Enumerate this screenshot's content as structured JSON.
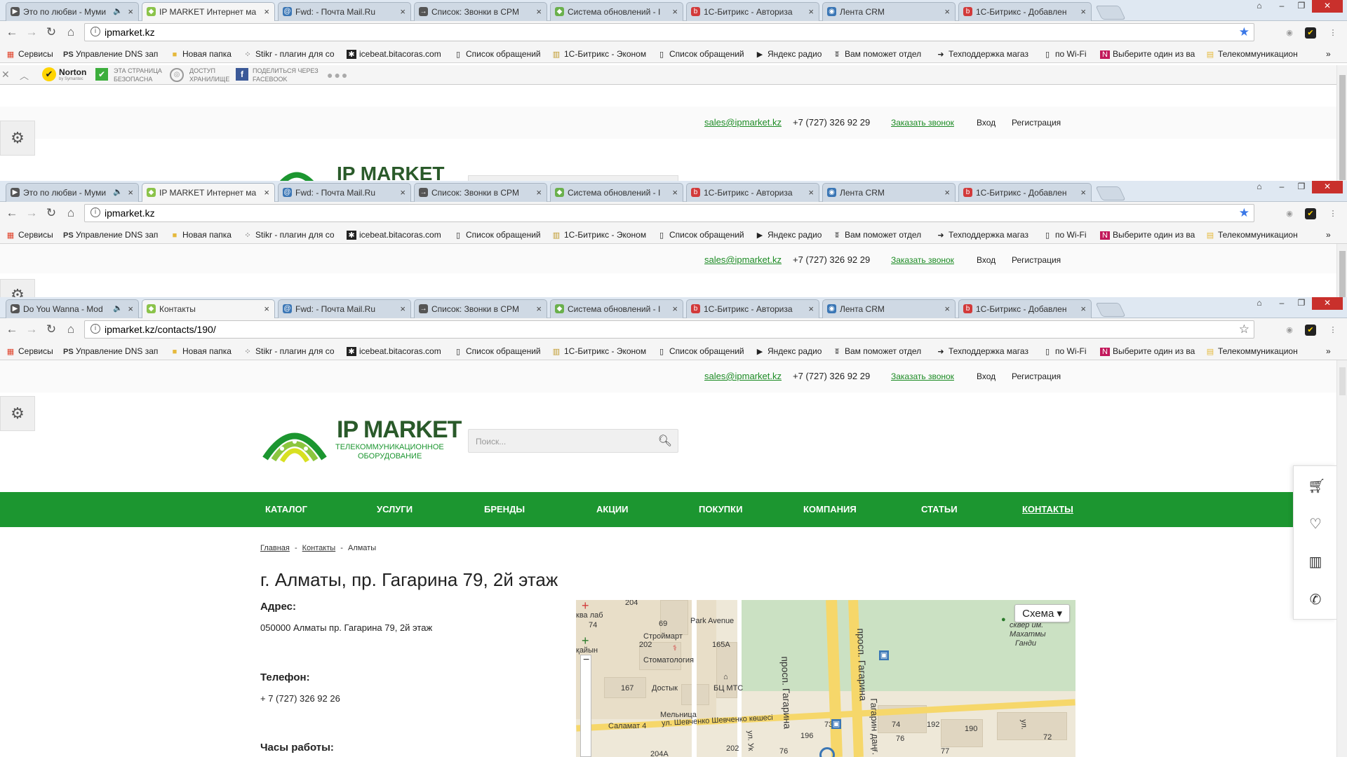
{
  "window1": {
    "tabs": [
      {
        "title": "Это по любви - Муми"
      },
      {
        "title": "IP MARKET Интернет ма"
      },
      {
        "title": "Fwd: - Почта Mail.Ru"
      },
      {
        "title": "Список: Звонки в CPM"
      },
      {
        "title": "Система обновлений - I"
      },
      {
        "title": "1С-Битрикс - Авториза"
      },
      {
        "title": "Лента CRM"
      },
      {
        "title": "1С-Битрикс - Добавлен"
      }
    ],
    "url": "ipmarket.kz"
  },
  "window2": {
    "tabs": [
      {
        "title": "Это по любви - Муми"
      },
      {
        "title": "IP MARKET Интернет ма"
      },
      {
        "title": "Fwd: - Почта Mail.Ru"
      },
      {
        "title": "Список: Звонки в CPM"
      },
      {
        "title": "Система обновлений - I"
      },
      {
        "title": "1С-Битрикс - Авториза"
      },
      {
        "title": "Лента CRM"
      },
      {
        "title": "1С-Битрикс - Добавлен"
      }
    ],
    "url": "ipmarket.kz"
  },
  "window3": {
    "tabs": [
      {
        "title": "Do You Wanna - Mod"
      },
      {
        "title": "Контакты"
      },
      {
        "title": "Fwd: - Почта Mail.Ru"
      },
      {
        "title": "Список: Звонки в CPM"
      },
      {
        "title": "Система обновлений - I"
      },
      {
        "title": "1С-Битрикс - Авториза"
      },
      {
        "title": "Лента CRM"
      },
      {
        "title": "1С-Битрикс - Добавлен"
      }
    ],
    "url": "ipmarket.kz/contacts/190/"
  },
  "bookmarks": [
    "Сервисы",
    "Управление DNS зап",
    "Новая папка",
    "Stikr - плагин для со",
    "icebeat.bitacoras.com",
    "Список обращений",
    "1С-Битрикс - Эконом",
    "Список обращений",
    "Яндекс радио",
    "Вам поможет отдел",
    "Техподдержка магаз",
    "по Wi-Fi",
    "Выберите один из ва",
    "Телекоммуникацион"
  ],
  "norton": {
    "brand": "Norton",
    "brand_sub": "by Symantec",
    "safe_1": "ЭТА СТРАНИЦА",
    "safe_2": "БЕЗОПАСНА",
    "vault_1": "ДОСТУП",
    "vault_2": "ХРАНИЛИЩЕ",
    "fb_1": "ПОДЕЛИТЬСЯ ЧЕРЕЗ",
    "fb_2": "FACEBOOK"
  },
  "site": {
    "email": "sales@ipmarket.kz",
    "phone": "+7 (727) 326 92 29",
    "callback": "Заказать звонок",
    "login": "Вход",
    "register": "Регистрация",
    "logo_title": "IP MARKET",
    "logo_sub1": "ТЕЛЕКОММУНИКАЦИОННОЕ",
    "logo_sub2": "ОБОРУДОВАНИЕ",
    "search_placeholder": "Поиск...",
    "menu": [
      "КАТАЛОГ",
      "УСЛУГИ",
      "БРЕНДЫ",
      "АКЦИИ",
      "ПОКУПКИ",
      "КОМПАНИЯ",
      "СТАТЬИ",
      "КОНТАКТЫ"
    ],
    "breadcrumbs": [
      "Главная",
      "Контакты",
      "Алматы"
    ],
    "page_title": "г. Алматы, пр. Гагарина 79, 2й этаж",
    "address_label": "Адрес:",
    "address_value": "050000 Алматы пр. Гагарина 79, 2й этаж",
    "phone_label": "Телефон:",
    "phone_value": "+ 7 (727) 326 92 26",
    "hours_label": "Часы работы:"
  },
  "map": {
    "type_button": "Схема ▾",
    "labels": {
      "park_avenue": "Park Avenue",
      "stroymart": "Строймарт",
      "stomatology": "Стоматология",
      "bc_mts": "БЦ МТС",
      "dostyk": "Достык",
      "melnitsa": "Мельница",
      "salamat": "Саламат 4",
      "shevchenko": "ул. Шевченко Шевченко көшесі",
      "gagarin": "просп. Гагарина",
      "gagarin2": "Гагарин даңғ.",
      "square1": "сквер им.",
      "square2": "Махатмы",
      "square3": "Ганди",
      "kava": "ква лаб",
      "kaiyn": "қайын",
      "n204": "204",
      "n69": "69",
      "n74": "74",
      "n202": "202",
      "n165a": "165А",
      "n167": "167",
      "n74b": "74",
      "n192": "192",
      "n190": "190",
      "n76": "76",
      "n72": "72",
      "n196": "196",
      "n73": "73",
      "n202b": "202",
      "n76b": "76",
      "n77": "77",
      "n204a": "204А",
      "uly_ukr": "ул. Ук",
      "ul": "ул."
    }
  },
  "colors": {
    "brand_green": "#1c9630",
    "link_green": "#1c8b24"
  }
}
